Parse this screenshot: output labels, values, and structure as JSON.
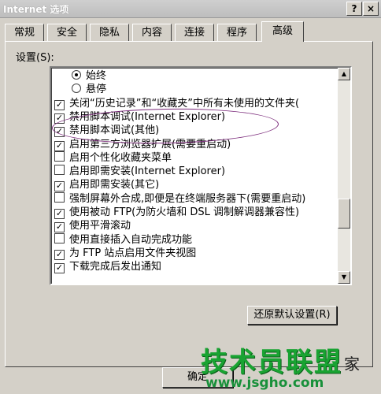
{
  "window": {
    "title": "Internet 选项",
    "help_button": "?",
    "close_button": "×"
  },
  "tabs": [
    {
      "label": "常规",
      "active": false
    },
    {
      "label": "安全",
      "active": false
    },
    {
      "label": "隐私",
      "active": false
    },
    {
      "label": "内容",
      "active": false
    },
    {
      "label": "连接",
      "active": false
    },
    {
      "label": "程序",
      "active": false
    },
    {
      "label": "高级",
      "active": true
    }
  ],
  "settings": {
    "label": "设置(S):",
    "items": [
      {
        "type": "radio",
        "checked": true,
        "label": "始终",
        "indent": true
      },
      {
        "type": "radio",
        "checked": false,
        "label": "悬停",
        "indent": true
      },
      {
        "type": "checkbox",
        "checked": true,
        "label": "关闭“历史记录”和“收藏夹”中所有未使用的文件夹("
      },
      {
        "type": "checkbox",
        "checked": true,
        "label": "禁用脚本调试(Internet Explorer)"
      },
      {
        "type": "checkbox",
        "checked": true,
        "label": "禁用脚本调试(其他)"
      },
      {
        "type": "checkbox",
        "checked": true,
        "label": "启用第三方浏览器扩展(需要重启动)"
      },
      {
        "type": "checkbox",
        "checked": false,
        "label": "启用个性化收藏夹菜单"
      },
      {
        "type": "checkbox",
        "checked": false,
        "label": "启用即需安装(Internet Explorer)"
      },
      {
        "type": "checkbox",
        "checked": true,
        "label": "启用即需安装(其它)"
      },
      {
        "type": "checkbox",
        "checked": false,
        "label": "强制屏幕外合成,即便是在终端服务器下(需要重启动)"
      },
      {
        "type": "checkbox",
        "checked": true,
        "label": "使用被动 FTP(为防火墙和 DSL 调制解调器兼容性)"
      },
      {
        "type": "checkbox",
        "checked": true,
        "label": "使用平滑滚动"
      },
      {
        "type": "checkbox",
        "checked": false,
        "label": "使用直接插入自动完成功能"
      },
      {
        "type": "checkbox",
        "checked": true,
        "label": "为 FTP 站点启用文件夹视图"
      },
      {
        "type": "checkbox",
        "checked": true,
        "label": "下载完成后发出通知"
      }
    ]
  },
  "buttons": {
    "restore_defaults": "还原默认设置(R)",
    "ok": "确定"
  },
  "watermark": {
    "main": "技术员联盟",
    "sub": "www.jsgho.com",
    "suffix": "家"
  },
  "colors": {
    "dialog_bg": "#d4d0c8",
    "annotation_oval": "#7a2a7a",
    "watermark_green": "#19a332"
  }
}
